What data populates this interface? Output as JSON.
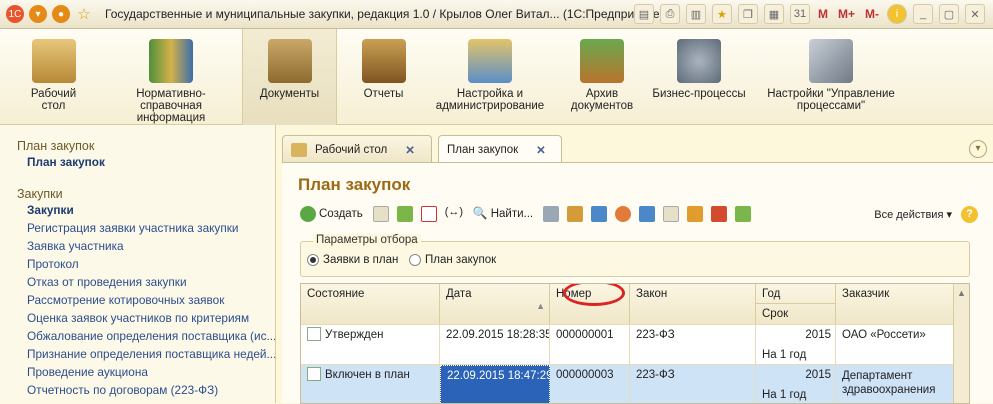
{
  "window": {
    "title": "Государственные и муниципальные закупки, редакция 1.0 / Крылов Олег Витал...   (1С:Предприятие)",
    "tool_labels": [
      "M",
      "M+",
      "M-"
    ]
  },
  "sections": [
    {
      "label": "Рабочий стол",
      "icon": "desk-lamp-icon"
    },
    {
      "label": "Нормативно-справочная информация",
      "icon": "binders-icon"
    },
    {
      "label": "Документы",
      "icon": "folder-documents-icon"
    },
    {
      "label": "Отчеты",
      "icon": "bookshelf-icon"
    },
    {
      "label": "Настройка и администрирование",
      "icon": "database-computer-icon"
    },
    {
      "label": "Архив документов",
      "icon": "archive-box-icon"
    },
    {
      "label": "Бизнес-процессы",
      "icon": "gears-icon"
    },
    {
      "label": "Настройки \"Управление процессами\"",
      "icon": "wrench-icon"
    }
  ],
  "sidebar": {
    "group1": "План закупок",
    "group1_items": [
      "План закупок"
    ],
    "group2": "Закупки",
    "group2_items": [
      "Закупки",
      "Регистрация заявки участника закупки",
      "Заявка участника",
      "Протокол",
      "Отказ от проведения закупки",
      "Рассмотрение котировочных заявок",
      "Оценка заявок участников по критериям",
      "Обжалование определения поставщика (ис...",
      "Признание определения поставщика недей...",
      "Проведение аукциона",
      "Отчетность по договорам (223-ФЗ)"
    ]
  },
  "tabs": [
    {
      "label": "Рабочий стол"
    },
    {
      "label": "План закупок"
    }
  ],
  "page_title": "План закупок",
  "toolbar": {
    "create": "Создать",
    "find": "Найти...",
    "all_actions": "Все действия ▾",
    "help": "?"
  },
  "filter": {
    "legend": "Параметры отбора",
    "option1": "Заявки в план",
    "option2": "План закупок",
    "selected": "Заявки в план"
  },
  "table": {
    "headers": {
      "status": "Состояние",
      "date": "Дата",
      "number": "Номер",
      "law": "Закон",
      "year": "Год",
      "term": "Срок",
      "customer": "Заказчик"
    },
    "rows": [
      {
        "status": "Утвержден",
        "date": "22.09.2015 18:28:35",
        "number": "000000001",
        "law": "223-ФЗ",
        "year": "2015",
        "term": "На 1 год",
        "customer": "ОАО «Россети»",
        "customer2": ""
      },
      {
        "status": "Включен в план",
        "date": "22.09.2015 18:47:29",
        "number": "000000003",
        "law": "223-ФЗ",
        "year": "2015",
        "term": "На 1 год",
        "customer": "Департамент",
        "customer2": "здравоохранения"
      }
    ]
  },
  "colors": {
    "accent_title": "#9b6a18",
    "link": "#2b4d8e",
    "selection": "#cfe3f7",
    "highlight_oval": "#d22222"
  }
}
